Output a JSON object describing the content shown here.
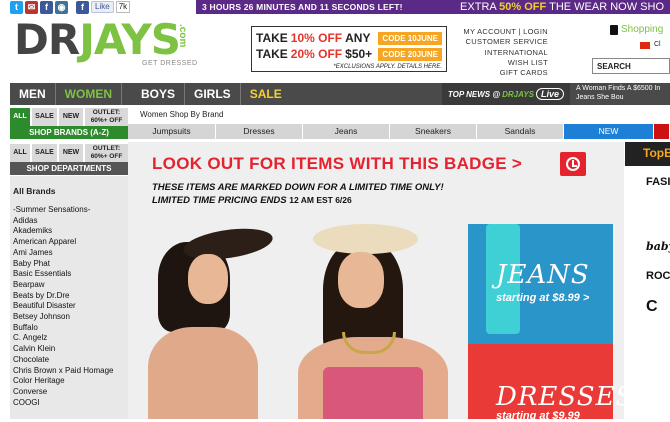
{
  "social": {
    "like_label": "Like",
    "like_count": "7k"
  },
  "promo": {
    "timer": "3 HOURS 26 MINUTES AND 11 SECONDS LEFT!",
    "sale_prefix": "EXTRA ",
    "sale_pct": "50% OFF",
    "sale_suffix": " THE WEAR NOW SHO"
  },
  "logo": {
    "dr": "DR",
    "jays": "JAYS",
    "com": ".com",
    "tagline": "GET DRESSED"
  },
  "coupon": {
    "row1_take": "TAKE",
    "row1_pct": "10% OFF",
    "row1_rest": "ANY",
    "row1_code": "CODE 10JUNE",
    "row2_take": "TAKE",
    "row2_pct": "20% OFF",
    "row2_rest": "$50+",
    "row2_code": "CODE 20JUNE",
    "exclusions": "*EXCLUSIONS APPLY. DETAILS HERE."
  },
  "account": [
    "MY ACCOUNT | LOGIN",
    "CUSTOMER SERVICE",
    "INTERNATIONAL",
    "WISH LIST",
    "GIFT CARDS"
  ],
  "shopping_label": "Shopping",
  "flag_label": "Cl",
  "search_label": "SEARCH",
  "nav": {
    "men": "MEN",
    "women": "WOMEN",
    "boys": "BOYS",
    "girls": "GIRLS",
    "sale": "SALE",
    "topnews": "TOP NEWS @",
    "topnews_brand": "DRJAYS",
    "live": "Live",
    "ticker": "A Woman Finds A $6500 In Jeans She Bou"
  },
  "tabs1": [
    "ALL",
    "SALE",
    "NEW",
    "OUTLET: 60%+ OFF"
  ],
  "shop_brands": "SHOP BRANDS (A-Z)",
  "tabs2": [
    "ALL",
    "SALE",
    "NEW",
    "OUTLET: 60%+ OFF"
  ],
  "shop_departments": "SHOP DEPARTMENTS",
  "breadcrumb": "Women Shop By Brand",
  "categories": [
    "Jumpsuits",
    "Dresses",
    "Jeans",
    "Sneakers",
    "Sandals",
    "NEW",
    ""
  ],
  "sidebar": {
    "header": "All Brands",
    "brands": [
      "-Summer Sensations-",
      "Adidas",
      "Akademiks",
      "American Apparel",
      "Ami James",
      "Baby Phat",
      "Basic Essentials",
      "Bearpaw",
      "Beats by Dr.Dre",
      "Beautiful Disaster",
      "Betsey Johnson",
      "Buffalo",
      "C. Angelz",
      "Calvin Klein",
      "Chocolate",
      "Chris Brown x Paid Homage",
      "Color Heritage",
      "Converse",
      "COOGI"
    ]
  },
  "hero": {
    "title": "LOOK OUT FOR ITEMS WITH THIS BADGE >",
    "line1": "THESE ITEMS ARE MARKED DOWN FOR A LIMITED TIME ONLY!",
    "line2": "LIMITED TIME PRICING ENDS",
    "time": "12 AM EST 6/26",
    "jeans_title": "JEANS",
    "jeans_sub": "starting at $8.99 >",
    "dresses_title": "DRESSES",
    "dresses_sub": "starting at $9.99"
  },
  "right": {
    "top_brands": "TopB",
    "logos": [
      "FASI",
      "",
      "baby",
      "ROC",
      "C",
      "",
      ""
    ]
  },
  "colors": {
    "accent": "#7dc243",
    "nav": "#4a4a4a",
    "badge": "#e4232e",
    "purple": "#5b2a86"
  }
}
